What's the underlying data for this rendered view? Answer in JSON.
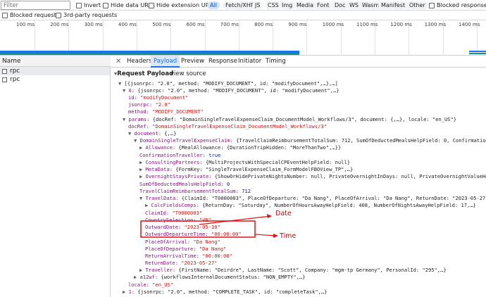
{
  "filter": {
    "placeholder": "Filter"
  },
  "toolbar": {
    "invert": "Invert",
    "hide_data_urls": "Hide data URLs",
    "hide_ext_urls": "Hide extension URLs",
    "types": [
      "All",
      "Fetch/XHR",
      "JS",
      "CSS",
      "Img",
      "Media",
      "Font",
      "Doc",
      "WS",
      "Wasm",
      "Manifest",
      "Other"
    ],
    "selected_type": "All",
    "blocked_cookies": "Blocked response coo",
    "blocked_requests": "Blocked requests",
    "third_party": "3rd-party requests"
  },
  "timeline": {
    "ticks": [
      "100 ms",
      "200 ms",
      "300 ms",
      "400 ms",
      "500 ms",
      "600 ms",
      "700 ms",
      "800 ms",
      "900 ms",
      "1000 ms",
      "1100 ms",
      "1200 ms",
      "1300 ms",
      "1400 ms"
    ]
  },
  "names": {
    "header": "Name",
    "rows": [
      "rpc",
      "rpc"
    ]
  },
  "tabs": [
    "Headers",
    "Payload",
    "Preview",
    "Response",
    "Initiator",
    "Timing"
  ],
  "active_tab": "Payload",
  "payload": {
    "title": "Request Payload",
    "view_source": "view source",
    "lines": [
      "[{jsonrpc: \"2.0\", method: \"MODIFY_DOCUMENT\", id: \"modifyDocument\",…},…]",
      "0: {jsonrpc: \"2.0\", method: \"MODIFY_DOCUMENT\", id: \"modifyDocument\",…}",
      "id: \"modifyDocument\"",
      "jsonrpc: \"2.0\"",
      "method: \"MODIFY_DOCUMENT\"",
      "params: {docRef: \"DomainSingleTravelExpenseClaim_DocumentModel_Workflows/3\", document: {,…}, locale: \"en_US\"}",
      "docRef: \"DomainSingleTravelExpenseClaim_DocumentModel_Workflows/3\"",
      "document: {,…}",
      "DomainSingleTravelExpenseClaim: {TravelClaimReimbursementTotalSum: 712, SumOfDeductedMealsHelpField: 0, ConfirmationTravel",
      "Allowance: {MealAllowance: {DurationTripHidden: \"MoreThanTwo\",…}}",
      "ConfirmationTraveller: true",
      "ConsultingPartners: {MultiProjectsWithSpecialCPEventHelpField: null}",
      "MetaData: {FormKey: \"SingleTravelExpenseClaim_FormModelFBOView_TP\",…}",
      "OvernightStaysPrivate: {ShowOrHidePrivateNightsNumber: null, PrivateOvernightInDays: null, PrivateOvernightValueHelpFiel",
      "SumOfDeductedMealsHelpField: 0",
      "TravelClaimReimbursementTotalSum: 712",
      "TravelData: {ClaimId: \"T0000003\", PlaceOfDeparture: \"Da Nang\", PlaceOfArrival: \"Da Nang\", ReturnDate: \"2023-05-27\",…}",
      "CalcFieldsComps: {ReturnDay: \"Saturday\", NumberOfHoursAwayHelpField: 408, NumberOfNightsAwayHelpField: 17,…}",
      "ClaimId: \"T0000003\"",
      "CountrySelection: \"VN\"",
      "OutwardDate: \"2023-05-10\"",
      "OutwardDepartureTime: \"00:00:00\"",
      "PlaceOfArrival: \"Da Nang\"",
      "PlaceOfDeparture: \"Da Nang\"",
      "ReturnArrivalTime: \"00:00:00\"",
      "ReturnDate: \"2023-05-27\"",
      "Traveller: {FirstName: \"Deirdre\", LastName: \"Scott\", Company: \"mgm-tp Germany\", PersonalId: \"295\",…}",
      "a12wf: {workflowsInternalDocumentStatus: \"NON_EMPTY\",…}",
      "locale: \"en_US\"",
      "1: {jsonrpc: \"2.0\", method: \"COMPLETE_TASK\", id: \"completeTask\",…}"
    ]
  },
  "annotations": {
    "date": "Date",
    "time": "Time"
  },
  "colors": {
    "accent": "#1a73e8",
    "annotation": "#e11111",
    "key": "#881280",
    "string": "#c41a16"
  }
}
